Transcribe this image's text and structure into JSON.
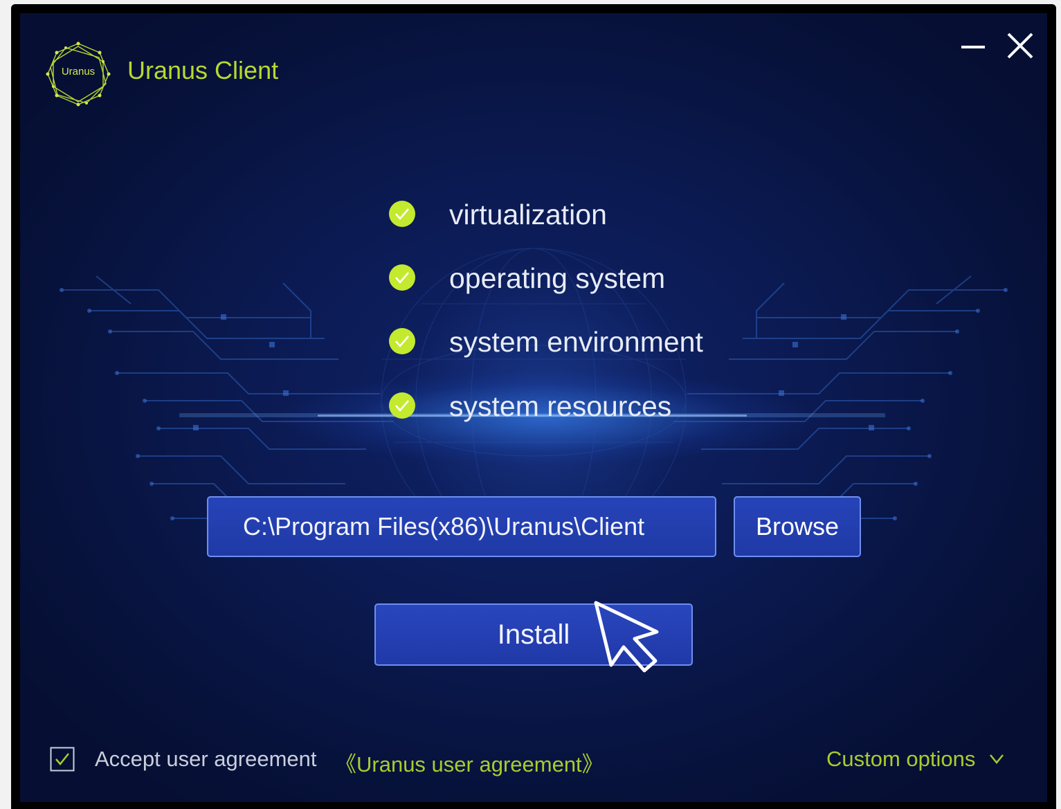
{
  "window": {
    "title": "Uranus Client",
    "logo_text": "Uranus",
    "minimize_icon": "minimize-icon",
    "close_icon": "close-icon"
  },
  "checks": [
    {
      "label": "virtualization",
      "status": "passed",
      "icon": "check-circle-icon"
    },
    {
      "label": "operating system",
      "status": "passed",
      "icon": "check-circle-icon"
    },
    {
      "label": "system environment",
      "status": "passed",
      "icon": "check-circle-icon"
    },
    {
      "label": "system resources",
      "status": "passed",
      "icon": "check-circle-icon"
    }
  ],
  "install_path": {
    "value": "C:\\Program Files(x86)\\Uranus\\Client"
  },
  "browse_button": {
    "label": "Browse"
  },
  "install_button": {
    "label": "Install"
  },
  "agreement": {
    "checked": true,
    "text": "Accept user agreement",
    "link": "《Uranus user agreement》"
  },
  "custom_options": {
    "label": "Custom options",
    "icon": "chevron-down-icon"
  },
  "colors": {
    "accent": "#a9cc2e",
    "check_green": "#c3ea2e",
    "button_blue": "#2441b4",
    "button_border": "#6f8ff0",
    "background": "#0b1a52"
  }
}
